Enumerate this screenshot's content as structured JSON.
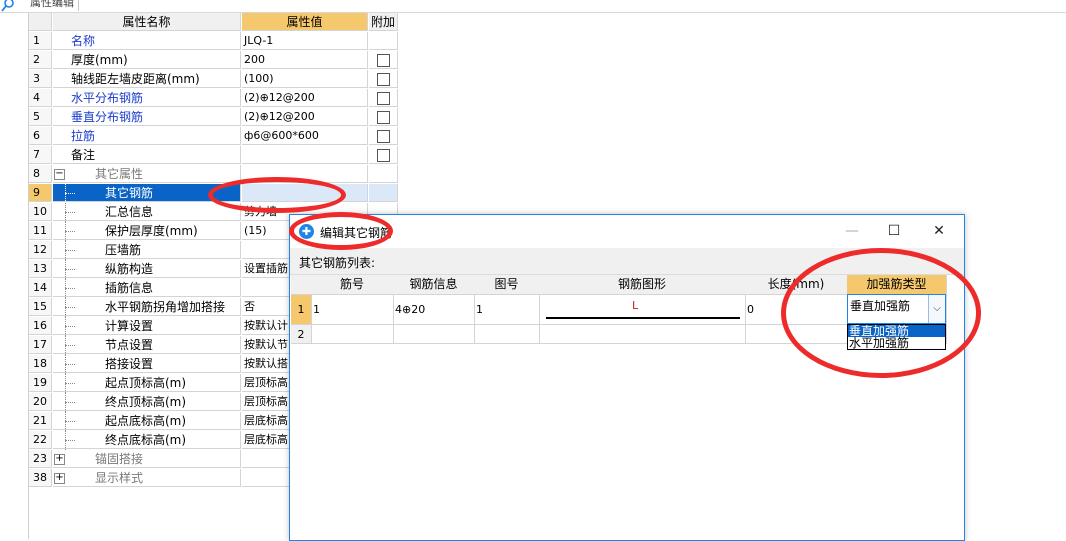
{
  "panel": {
    "title": "属性编辑"
  },
  "grid": {
    "headers": {
      "name": "属性名称",
      "value": "属性值",
      "extra": "附加"
    },
    "rows": [
      {
        "num": "1",
        "name": "名称",
        "value": "JLQ-1",
        "style": "blue",
        "check": false
      },
      {
        "num": "2",
        "name": "厚度(mm)",
        "value": "200",
        "style": "",
        "check": true
      },
      {
        "num": "3",
        "name": "轴线距左墙皮距离(mm)",
        "value": "(100)",
        "style": "",
        "check": true
      },
      {
        "num": "4",
        "name": "水平分布钢筋",
        "value": "(2)⊕12@200",
        "style": "blue",
        "check": true
      },
      {
        "num": "5",
        "name": "垂直分布钢筋",
        "value": "(2)⊕12@200",
        "style": "blue",
        "check": true
      },
      {
        "num": "6",
        "name": "拉筋",
        "value": "ф6@600*600",
        "style": "blue",
        "check": true
      },
      {
        "num": "7",
        "name": "备注",
        "value": "",
        "style": "",
        "check": true
      },
      {
        "num": "8",
        "name": "其它属性",
        "value": "",
        "style": "grey",
        "check": false,
        "expander": "−"
      },
      {
        "num": "9",
        "name": "其它钢筋",
        "value": "",
        "style": "",
        "check": false,
        "selected": true
      },
      {
        "num": "10",
        "name": "汇总信息",
        "value": "剪力墙",
        "style": "",
        "check": false
      },
      {
        "num": "11",
        "name": "保护层厚度(mm)",
        "value": "(15)",
        "style": "",
        "check": false
      },
      {
        "num": "12",
        "name": "压墙筋",
        "value": "",
        "style": "",
        "check": false
      },
      {
        "num": "13",
        "name": "纵筋构造",
        "value": "设置插筋",
        "style": "",
        "check": false
      },
      {
        "num": "14",
        "name": "插筋信息",
        "value": "",
        "style": "",
        "check": false
      },
      {
        "num": "15",
        "name": "水平钢筋拐角增加搭接",
        "value": "否",
        "style": "",
        "check": false
      },
      {
        "num": "16",
        "name": "计算设置",
        "value": "按默认计",
        "style": "",
        "check": false
      },
      {
        "num": "17",
        "name": "节点设置",
        "value": "按默认节",
        "style": "",
        "check": false
      },
      {
        "num": "18",
        "name": "搭接设置",
        "value": "按默认搭",
        "style": "",
        "check": false
      },
      {
        "num": "19",
        "name": "起点顶标高(m)",
        "value": "层顶标高",
        "style": "",
        "check": false
      },
      {
        "num": "20",
        "name": "终点顶标高(m)",
        "value": "层顶标高",
        "style": "",
        "check": false
      },
      {
        "num": "21",
        "name": "起点底标高(m)",
        "value": "层底标高",
        "style": "",
        "check": false
      },
      {
        "num": "22",
        "name": "终点底标高(m)",
        "value": "层底标高",
        "style": "",
        "check": false
      },
      {
        "num": "23",
        "name": "锚固搭接",
        "value": "",
        "style": "grey",
        "check": false,
        "expander": "+"
      },
      {
        "num": "38",
        "name": "显示样式",
        "value": "",
        "style": "grey",
        "check": false,
        "expander": "+"
      }
    ]
  },
  "dialog": {
    "title": "编辑其它钢筋",
    "list_label": "其它钢筋列表:",
    "minimize": "—",
    "maximize": "☐",
    "close": "✕",
    "columns": [
      "筋号",
      "钢筋信息",
      "图号",
      "钢筋图形",
      "长度(mm)",
      "加强筋类型"
    ],
    "rows": [
      {
        "num": "1",
        "cells": [
          "1",
          "4⊕20",
          "1",
          "L",
          "0",
          "垂直加强筋"
        ]
      },
      {
        "num": "2",
        "cells": [
          "",
          "",
          "",
          "",
          "",
          ""
        ]
      }
    ],
    "dropdown": {
      "selected": "垂直加强筋",
      "options": [
        "垂直加强筋",
        "水平加强筋"
      ]
    }
  },
  "colors": {
    "accent_header": "#f6c86e",
    "selection": "#0a64c8",
    "annotation": "#ee2b2b"
  }
}
